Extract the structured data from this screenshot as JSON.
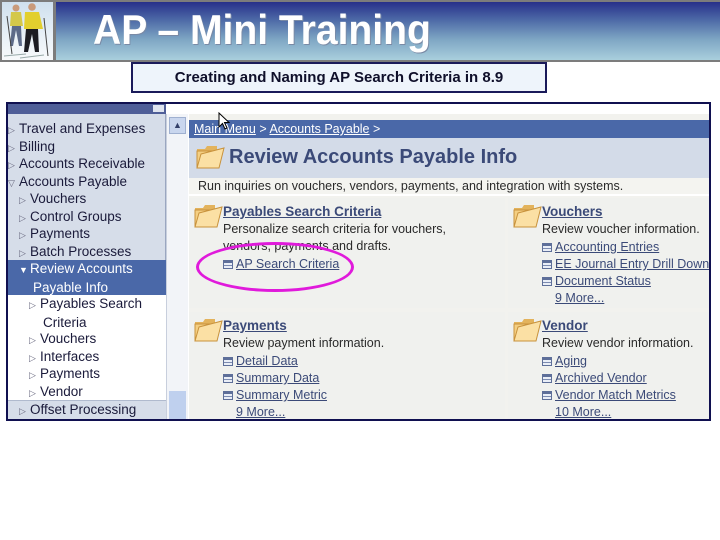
{
  "slide": {
    "title": "AP – Mini Training",
    "subtitle": "Creating and Naming AP Search Criteria in 8.9",
    "colors": {
      "banner_top": "#27308a",
      "banner_bottom": "#a9cfdd",
      "highlight": "#e01adb"
    }
  },
  "menu": {
    "items": [
      {
        "label": "Travel and Expenses",
        "icon": "collapsed-triangle-icon"
      },
      {
        "label": "Billing",
        "icon": "collapsed-triangle-icon"
      },
      {
        "label": "Accounts Receivable",
        "icon": "collapsed-triangle-icon"
      },
      {
        "label": "Accounts Payable",
        "icon": "expanded-triangle-icon"
      },
      {
        "label": "Vouchers",
        "icon": "collapsed-triangle-icon"
      },
      {
        "label": "Control Groups",
        "icon": "collapsed-triangle-icon"
      },
      {
        "label": "Payments",
        "icon": "collapsed-triangle-icon"
      },
      {
        "label": "Batch Processes",
        "icon": "collapsed-triangle-icon"
      },
      {
        "label": "Review Accounts",
        "label2": "Payable Info",
        "icon": "expanded-triangle-icon",
        "selected": true
      },
      {
        "label": "Payables Search",
        "label2": "Criteria",
        "icon": "collapsed-triangle-icon"
      },
      {
        "label": "Vouchers",
        "icon": "collapsed-triangle-icon"
      },
      {
        "label": "Interfaces",
        "icon": "collapsed-triangle-icon"
      },
      {
        "label": "Payments",
        "icon": "collapsed-triangle-icon"
      },
      {
        "label": "Vendor",
        "icon": "collapsed-triangle-icon"
      },
      {
        "label": "Offset Processing",
        "icon": "collapsed-triangle-icon"
      }
    ]
  },
  "breadcrumb": {
    "items": [
      "Main Menu",
      "Accounts Payable"
    ],
    "separator": ">"
  },
  "page": {
    "title": "Review Accounts Payable Info",
    "description": "Run inquiries on vouchers, vendors, payments, and integration with systems."
  },
  "panels": [
    {
      "title": "Payables Search Criteria",
      "description": "Personalize search criteria for vouchers, vendors, payments and drafts.",
      "links": [
        "AP Search Criteria"
      ],
      "more": null
    },
    {
      "title": "Vouchers",
      "description": "Review voucher information.",
      "links": [
        "Accounting Entries",
        "EE Journal Entry Drill Down",
        "Document Status"
      ],
      "more": "9 More..."
    },
    {
      "title": "Payments",
      "description": "Review payment information.",
      "links": [
        "Detail Data",
        "Summary Data",
        "Summary Metric"
      ],
      "more": "9 More..."
    },
    {
      "title": "Vendor",
      "description": "Review vendor information.",
      "links": [
        "Aging",
        "Archived Vendor",
        "Vendor Match Metrics"
      ],
      "more": "10 More..."
    }
  ],
  "icons": {
    "scroll_up": "▲",
    "collapsed": "▷",
    "expanded": "▽",
    "expanded_selected": "▼"
  }
}
